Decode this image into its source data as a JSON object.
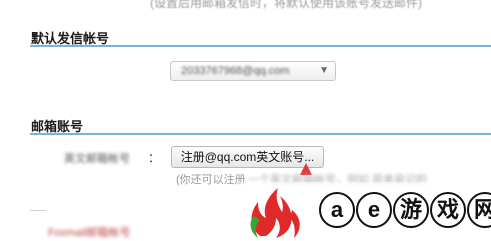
{
  "top_hint": "(设置后用邮箱发信时，将默认使用该账号发送邮件)",
  "default_sender": {
    "title": "默认发信帐号",
    "selected_value": "2033767968@qq.com"
  },
  "mailbox_account": {
    "title": "邮箱账号",
    "account_label": "英文邮箱帐号",
    "colon": "：",
    "register_button": "注册@qq.com英文账号...",
    "note_visible": "(你还可以注册",
    "note_blurred": "一个英文邮箱帐号，例如 简单易记的",
    "bottom_blurred": "Foxmail邮箱帐号"
  },
  "watermark": {
    "chars": [
      "a",
      "e",
      "游",
      "戏",
      "网"
    ],
    "flame_color": "#e02a2a",
    "leaf_color": "#3aa23a"
  },
  "colors": {
    "divider": "#7ab3d9",
    "cursor": "#e0393b"
  }
}
